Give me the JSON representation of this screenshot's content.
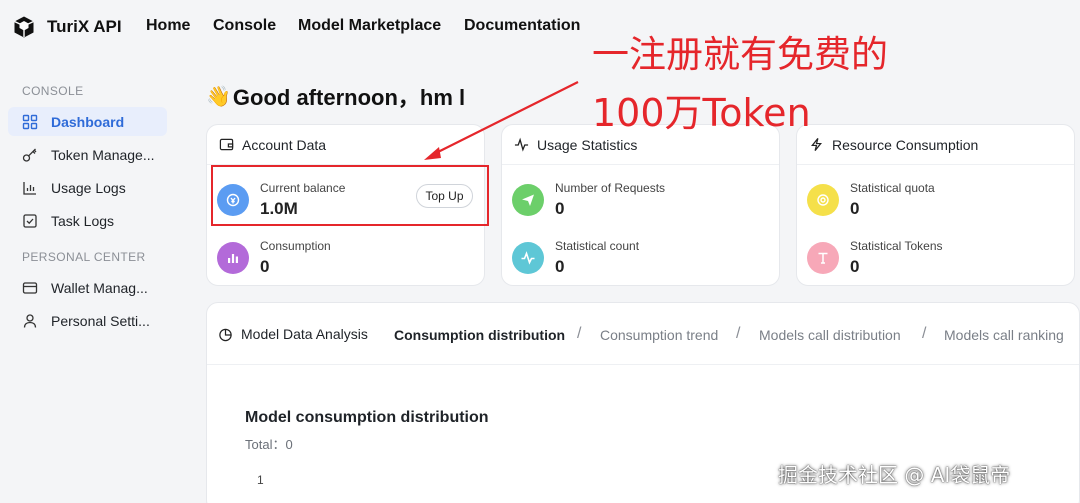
{
  "header": {
    "brand": "TuriX API",
    "nav": [
      "Home",
      "Console",
      "Model Marketplace",
      "Documentation"
    ]
  },
  "sidebar": {
    "sections": [
      {
        "title": "CONSOLE",
        "items": [
          {
            "label": "Dashboard",
            "icon": "dashboard-icon",
            "active": true
          },
          {
            "label": "Token Manage...",
            "icon": "key-icon"
          },
          {
            "label": "Usage Logs",
            "icon": "bar-chart-icon"
          },
          {
            "label": "Task Logs",
            "icon": "checklist-icon"
          }
        ]
      },
      {
        "title": "PERSONAL CENTER",
        "items": [
          {
            "label": "Wallet Manag...",
            "icon": "wallet-icon"
          },
          {
            "label": "Personal Setti...",
            "icon": "user-icon"
          }
        ]
      }
    ]
  },
  "greeting": {
    "emoji": "👋",
    "text": "Good afternoon，hm l"
  },
  "cards": [
    {
      "title": "Account Data",
      "icon": "wallet-card-icon",
      "stats": [
        {
          "label": "Current balance",
          "value": "1.0M",
          "icon": "coin-icon",
          "color": "#5b9cf2"
        },
        {
          "label": "Consumption",
          "value": "0",
          "icon": "bar-chart-icon",
          "color": "#b36ad9"
        }
      ],
      "button": "Top Up"
    },
    {
      "title": "Usage Statistics",
      "icon": "pulse-icon",
      "stats": [
        {
          "label": "Number of Requests",
          "value": "0",
          "icon": "send-icon",
          "color": "#6ccf6a"
        },
        {
          "label": "Statistical count",
          "value": "0",
          "icon": "pulse-icon",
          "color": "#5ec7d6"
        }
      ]
    },
    {
      "title": "Resource Consumption",
      "icon": "bolt-icon",
      "stats": [
        {
          "label": "Statistical quota",
          "value": "0",
          "icon": "coin-icon",
          "color": "#f5e04a"
        },
        {
          "label": "Statistical Tokens",
          "value": "0",
          "icon": "text-icon",
          "color": "#f7a8b8"
        }
      ]
    }
  ],
  "annotation": {
    "line1": "一注册就有免费的",
    "line2": "100万Token",
    "color": "#e5262b"
  },
  "analysis": {
    "title": "Model Data Analysis",
    "tabs": [
      "Consumption distribution",
      "Consumption trend",
      "Models call distribution",
      "Models call ranking"
    ],
    "active_tab": 0,
    "chart_title": "Model consumption distribution",
    "total": "Total：0",
    "tick": "1"
  },
  "watermark": "掘金技术社区 @ AI袋鼠帝"
}
